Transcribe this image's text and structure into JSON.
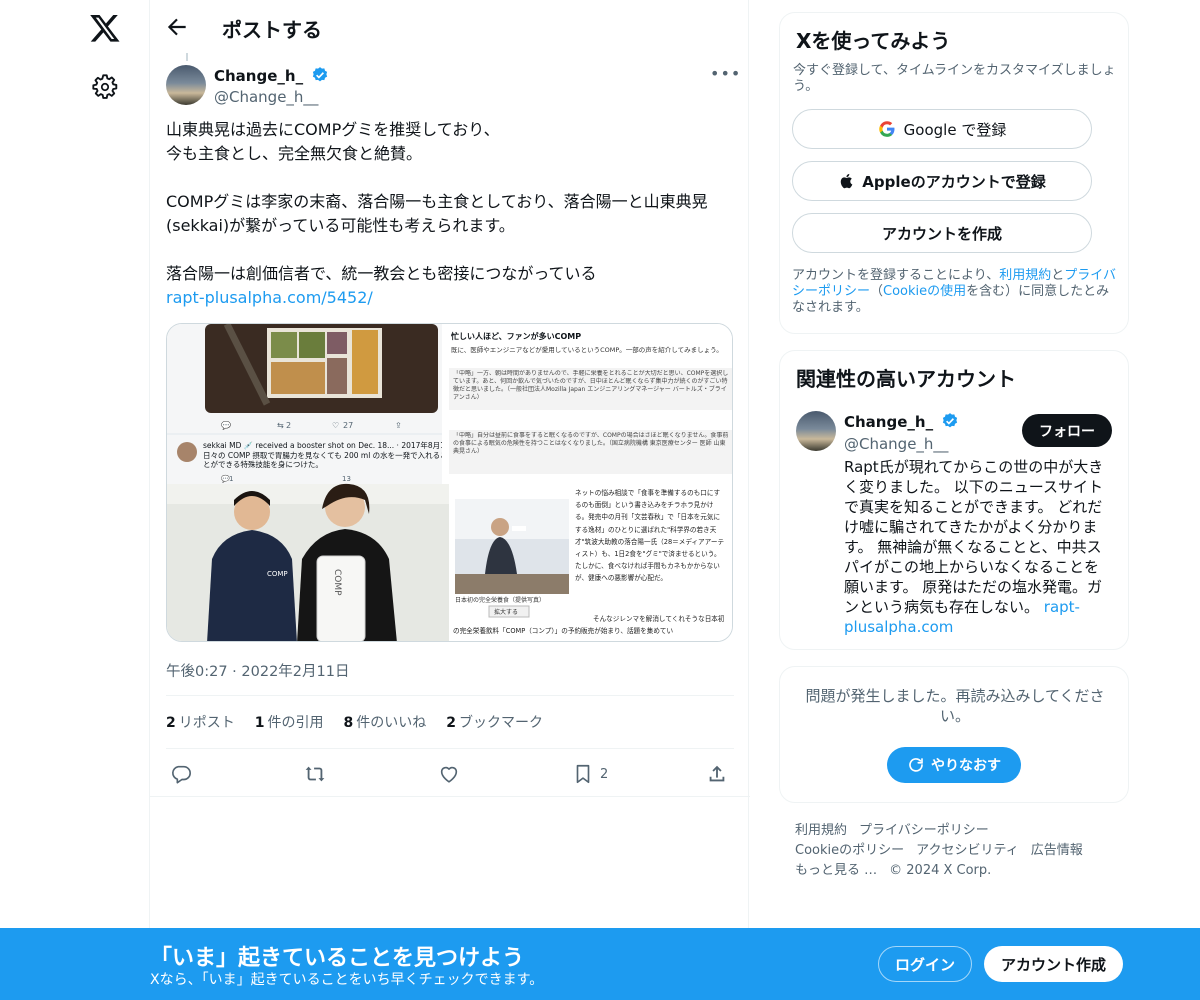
{
  "header": {
    "title": "ポストする"
  },
  "post": {
    "author_name": "Change_h_",
    "author_handle": "@Change_h__",
    "text": "山東典晃は過去にCOMPグミを推奨しており、\n今も主食とし、完全無欠食と絶賛。\n\nCOMPグミは李家の末裔、落合陽一も主食としており、落合陽一と山東典晃(sekkai)が繋がっている可能性も考えられます。\n\n落合陽一は創価信者で、統一教会とも密接につながっている",
    "link": "rapt-plusalpha.com/5452/",
    "timestamp": "午後0:27 · 2022年2月11日",
    "stats": [
      {
        "count": "2",
        "label": "リポスト"
      },
      {
        "count": "1",
        "label": "件の引用"
      },
      {
        "count": "8",
        "label": "件のいいね"
      },
      {
        "count": "2",
        "label": "ブックマーク"
      }
    ],
    "bookmark_count": "2",
    "media": {
      "tweet_reply_count": "2",
      "tweet_like_count": "27",
      "tweet_reply_count_2": "1",
      "tweet_like_count_2": "13",
      "embedded_tweet_header": "sekkai MD 💉 received a booster shot on Dec. 18... · 2017年8月14日",
      "embedded_tweet_text": "日々の COMP 摂取で胃腸力を見なくても 200 ml の水を一発で入れることができる特殊技能を身につけた。",
      "article_title": "忙しい人ほど、ファンが多いCOMP",
      "article_lead": "既に、医師やエンジニアなどが愛用しているというCOMP。一部の声を紹介してみましょう。",
      "article_quote_1": "「中略」一方、朝は時間がありませんので、手軽に栄養をとれることが大切だと思い、COMPを選択しています。あと、何回か飲んで気づいたのですが、日中ほとんど眠くならず集中力が続くのがすごい特徴だと思いました。（一般社団法人Mozilla Japan エンジニアリングマネージャー バートルズ・ブライアンさん）",
      "article_quote_2": "「中略」自分は昼前に食事をすると眠くなるのですが、COMPの場合はさほど眠くなりません。食事前の食事による眠気の危険性を持つことはなくなりました。（国立病院機構 東京医療センター 医師 山東典晃さん）",
      "bottle_label": "COMP",
      "shirt_label": "COMP",
      "magazine_text_1": "ネットの悩み相談で「食事を準備するのも口にするのも面倒」という書き込みをチラホラ見かける。発売中の月刊「文芸春秋」で「日本を元気にする逸材」のひとりに選ばれた\"科学界の若き天才\"筑波大助教の落合陽一氏（28＝メディアアーティスト）も、1日2食を\"グミ\"で済ませるという。たしかに、食べなければ手間もカネもかからないが、健康への悪影響が心配だ。",
      "magazine_caption": "日本初の完全栄養食（提供写真）",
      "magazine_zoom": "拡大する",
      "magazine_text_2": "そんなジレンマを解消してくれそうな日本初の完全栄養飲料「COMP（コンプ）」の予約販売が始まり、話題を集めてい"
    }
  },
  "signup_card": {
    "title": "Xを使ってみよう",
    "subtitle": "今すぐ登録して、タイムラインをカスタマイズしましょう。",
    "google_btn": "Google で登録",
    "apple_btn": "Appleのアカウントで登録",
    "create_btn": "アカウントを作成",
    "legal_prefix": "アカウントを登録することにより、",
    "legal_terms": "利用規約",
    "legal_and": "と",
    "legal_privacy": "プライバシーポリシー",
    "legal_paren_open": "（",
    "legal_cookie": "Cookieの使用",
    "legal_suffix": "を含む）に同意したとみなされます。"
  },
  "related_card": {
    "title": "関連性の高いアカウント",
    "name": "Change_h_",
    "handle": "@Change_h__",
    "follow_btn": "フォロー",
    "bio": "Rapt氏が現れてからこの世の中が大きく変りました。 以下のニュースサイトで真実を知ることができます。 どれだけ嘘に騙されてきたかがよく分かります。 無神論が無くなることと、中共スパイがこの地上からいなくなることを願います。 原発はただの塩水発電。ガンという病気も存在しない。",
    "bio_link": "rapt-plusalpha.com"
  },
  "error_card": {
    "text": "問題が発生しました。再読み込みしてください。",
    "retry_btn": "やりなおす"
  },
  "footer": {
    "row1": [
      "利用規約",
      "プライバシーポリシー"
    ],
    "row2": [
      "Cookieのポリシー",
      "アクセシビリティ",
      "広告情報"
    ],
    "more": "もっと見る …",
    "copyright": "© 2024 X Corp."
  },
  "banner": {
    "title": "「いま」起きていることを見つけよう",
    "subtitle": "Xなら、「いま」起きていることをいち早くチェックできます。",
    "login_btn": "ログイン",
    "signup_btn": "アカウント作成"
  },
  "colors": {
    "accent": "#1d9bf0",
    "text": "#0f1419",
    "secondary": "#536471",
    "border": "#eff3f4"
  }
}
